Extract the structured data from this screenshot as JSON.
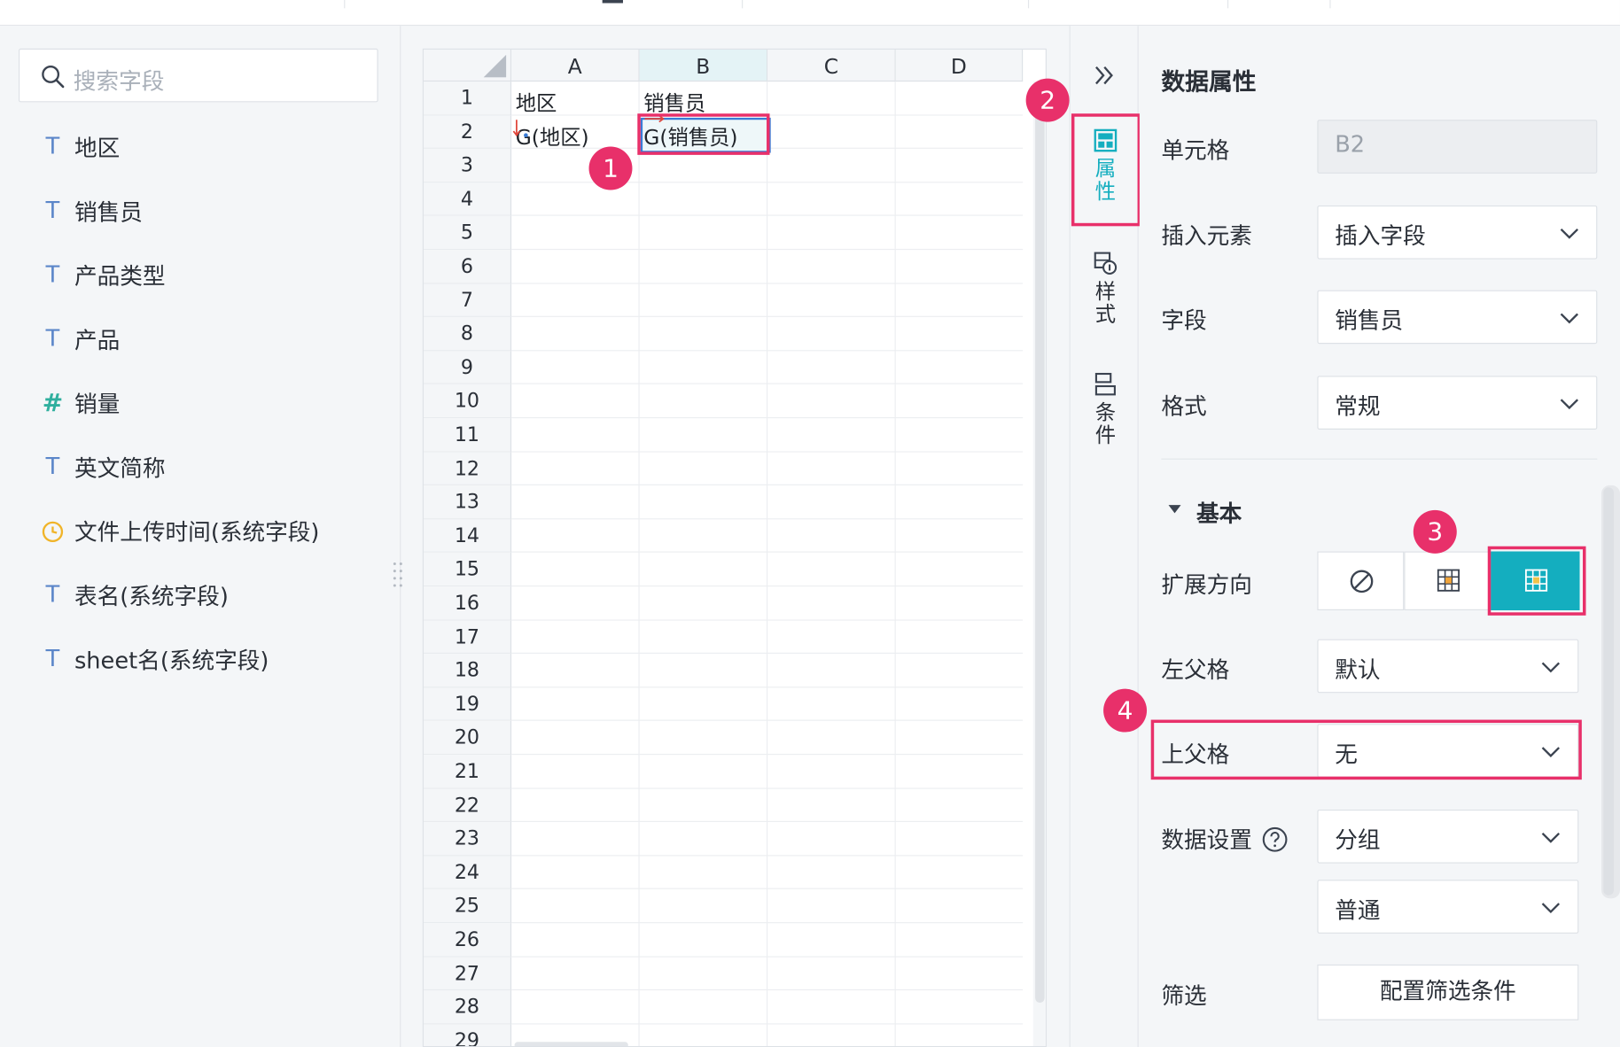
{
  "search": {
    "placeholder": "搜索字段"
  },
  "fields": [
    {
      "label": "地区",
      "icon": "text-type-icon"
    },
    {
      "label": "销售员",
      "icon": "text-type-icon"
    },
    {
      "label": "产品类型",
      "icon": "text-type-icon"
    },
    {
      "label": "产品",
      "icon": "text-type-icon"
    },
    {
      "label": "销量",
      "icon": "number-type-icon"
    },
    {
      "label": "英文简称",
      "icon": "text-type-icon"
    },
    {
      "label": "文件上传时间(系统字段)",
      "icon": "datetime-type-icon"
    },
    {
      "label": "表名(系统字段)",
      "icon": "text-type-icon"
    },
    {
      "label": "sheet名(系统字段)",
      "icon": "text-type-icon"
    }
  ],
  "sheet": {
    "columns": [
      "A",
      "B",
      "C",
      "D"
    ],
    "rows": [
      "1",
      "2",
      "3",
      "4",
      "5",
      "6",
      "7",
      "8",
      "9",
      "10",
      "11",
      "12",
      "13",
      "14",
      "15",
      "16",
      "17",
      "18",
      "19",
      "20",
      "21",
      "22",
      "23",
      "24",
      "25",
      "26",
      "27",
      "28",
      "29"
    ],
    "cells": {
      "A1": "地区",
      "B1": "销售员",
      "A2": "G(地区)",
      "B2": "G(销售员)"
    },
    "selected_column": "B"
  },
  "badges": {
    "one": "1",
    "two": "2",
    "three": "3",
    "four": "4"
  },
  "tabs": {
    "collapse_glyph": "»",
    "properties": "属性",
    "style": "样式",
    "condition": "条件"
  },
  "props": {
    "title": "数据属性",
    "cell_label": "单元格",
    "cell_value": "B2",
    "insert_label": "插入元素",
    "insert_value": "插入字段",
    "field_label": "字段",
    "field_value": "销售员",
    "format_label": "格式",
    "format_value": "常规",
    "section_basic": "基本",
    "expand_label": "扩展方向",
    "left_parent_label": "左父格",
    "left_parent_value": "默认",
    "top_parent_label": "上父格",
    "top_parent_value": "无",
    "data_setting_label": "数据设置",
    "data_setting_value": "分组",
    "data_setting_value2": "普通",
    "filter_label": "筛选",
    "filter_button": "配置筛选条件"
  },
  "colors": {
    "accent": "#14aebf",
    "highlight": "#e8306a"
  }
}
